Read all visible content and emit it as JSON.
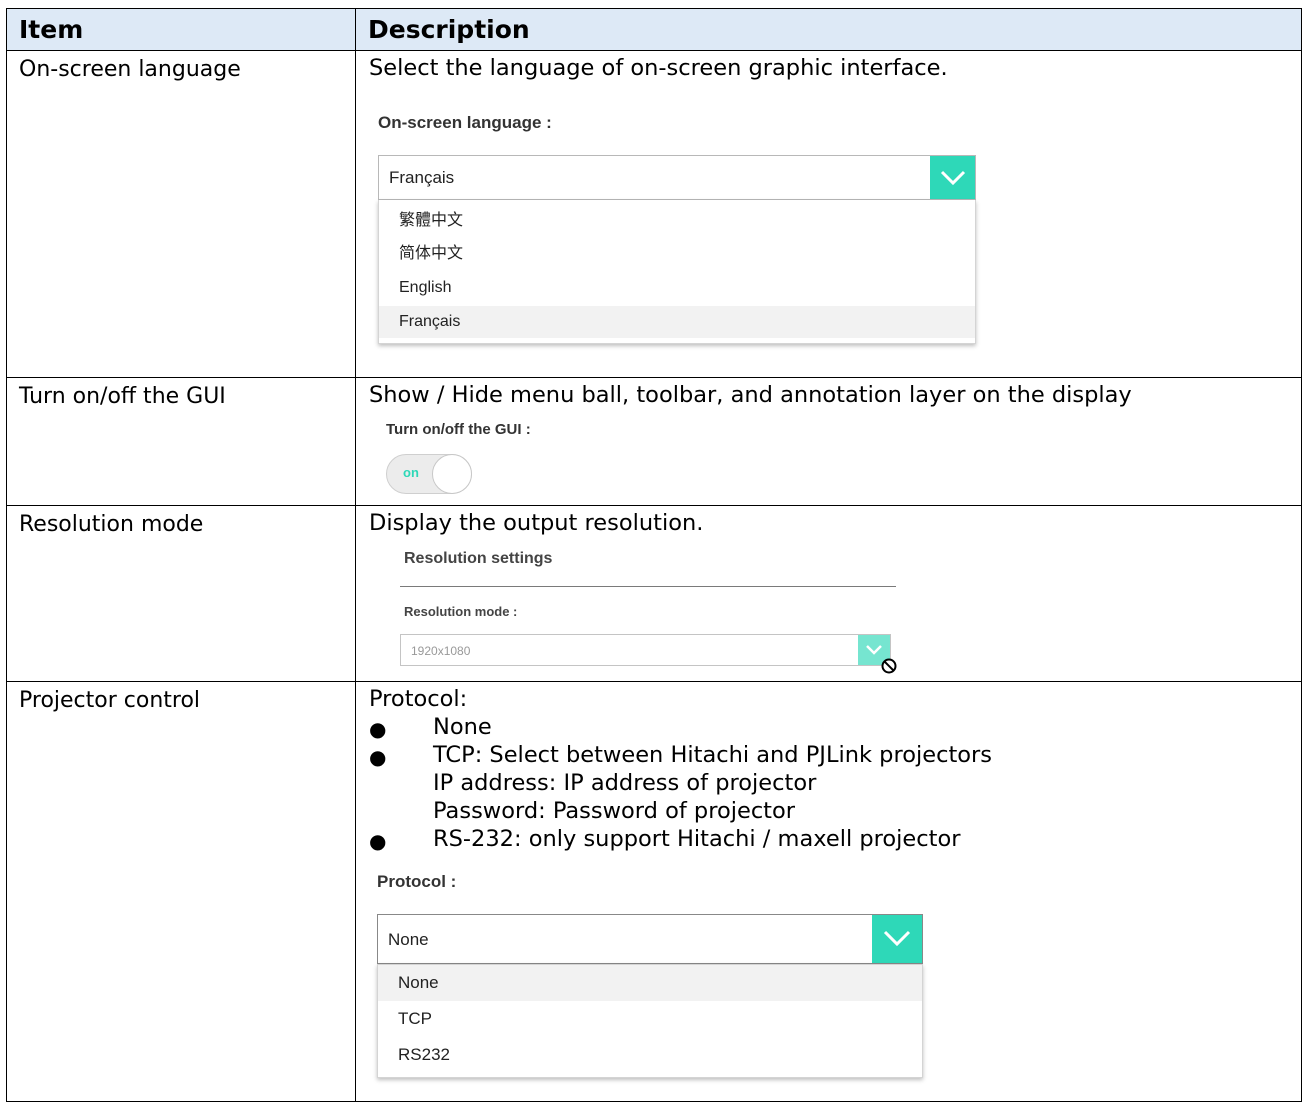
{
  "header": {
    "item": "Item",
    "description": "Description"
  },
  "rows": {
    "language": {
      "item": "On-screen language",
      "text": "Select the language of on-screen graphic interface.",
      "label": "On-screen language :",
      "selected": "Français",
      "options": [
        "繁體中文",
        "简体中文",
        "English",
        "Français"
      ]
    },
    "gui": {
      "item": "Turn on/off the GUI",
      "text": "Show / Hide menu ball, toolbar, and annotation layer on the display",
      "label": "Turn on/off the GUI :",
      "toggle": "on"
    },
    "resolution": {
      "item": "Resolution mode",
      "text": "Display the output resolution.",
      "section": "Resolution settings",
      "label": "Resolution mode :",
      "value": "1920x1080"
    },
    "projector": {
      "item": "Projector control",
      "intro": "Protocol:",
      "bullets": [
        "None",
        "TCP: Select between Hitachi and PJLink projectors",
        "RS-232: only support Hitachi / maxell projector"
      ],
      "tcp_sub": [
        "IP address: IP address of projector",
        "Password: Password of projector"
      ],
      "label": "Protocol :",
      "selected": "None",
      "options": [
        "None",
        "TCP",
        "RS232"
      ]
    }
  },
  "colors": {
    "accent": "#2ed8b8",
    "header_bg": "#dde9f6"
  }
}
